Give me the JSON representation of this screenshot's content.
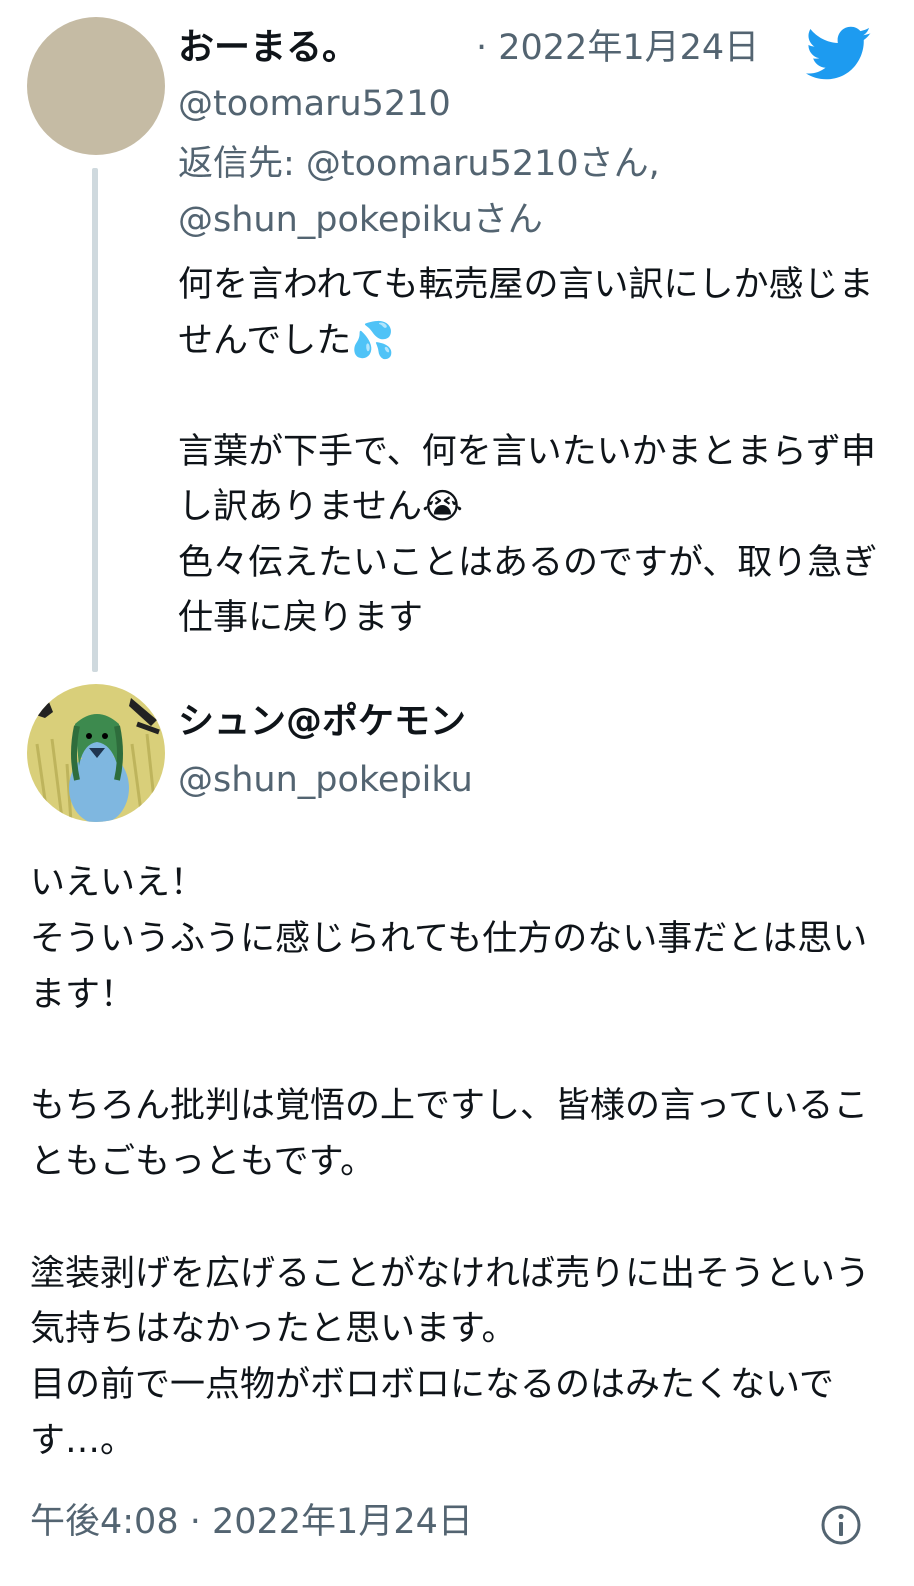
{
  "parent_tweet": {
    "author_name": "おーまる。",
    "date": "· 2022年1月24日",
    "handle": "@toomaru5210",
    "reply_to": "返信先: @toomaru5210さん, @shun_pokepikuさん",
    "body": "何を言われても転売屋の言い訳にしか感じませんでした💦\n\n言葉が下手で、何を言いたいかまとまらず申し訳ありません😭\n色々伝えたいことはあるのですが、取り急ぎ仕事に戻ります",
    "avatar_color": "#c5bba4"
  },
  "main_tweet": {
    "author_name": "シュン@ポケモン",
    "handle": "@shun_pokepiku",
    "body": "いえいえ！\nそういうふうに感じられても仕方のない事だとは思います！\n\nもちろん批判は覚悟の上ですし、皆様の言っていることもごもっともです。\n\n塗装剥げを広げることがなければ売りに出そうという気持ちはなかったと思います。\n目の前で一点物がボロボロになるのはみたくないです…。",
    "timestamp": "午後4:08 · 2022年1月24日"
  },
  "icons": {
    "brand": "twitter-bird-icon",
    "info": "info-icon"
  },
  "colors": {
    "brand_blue": "#1d9bf0",
    "secondary_text": "#536471",
    "thread_line": "#cfd9de"
  }
}
